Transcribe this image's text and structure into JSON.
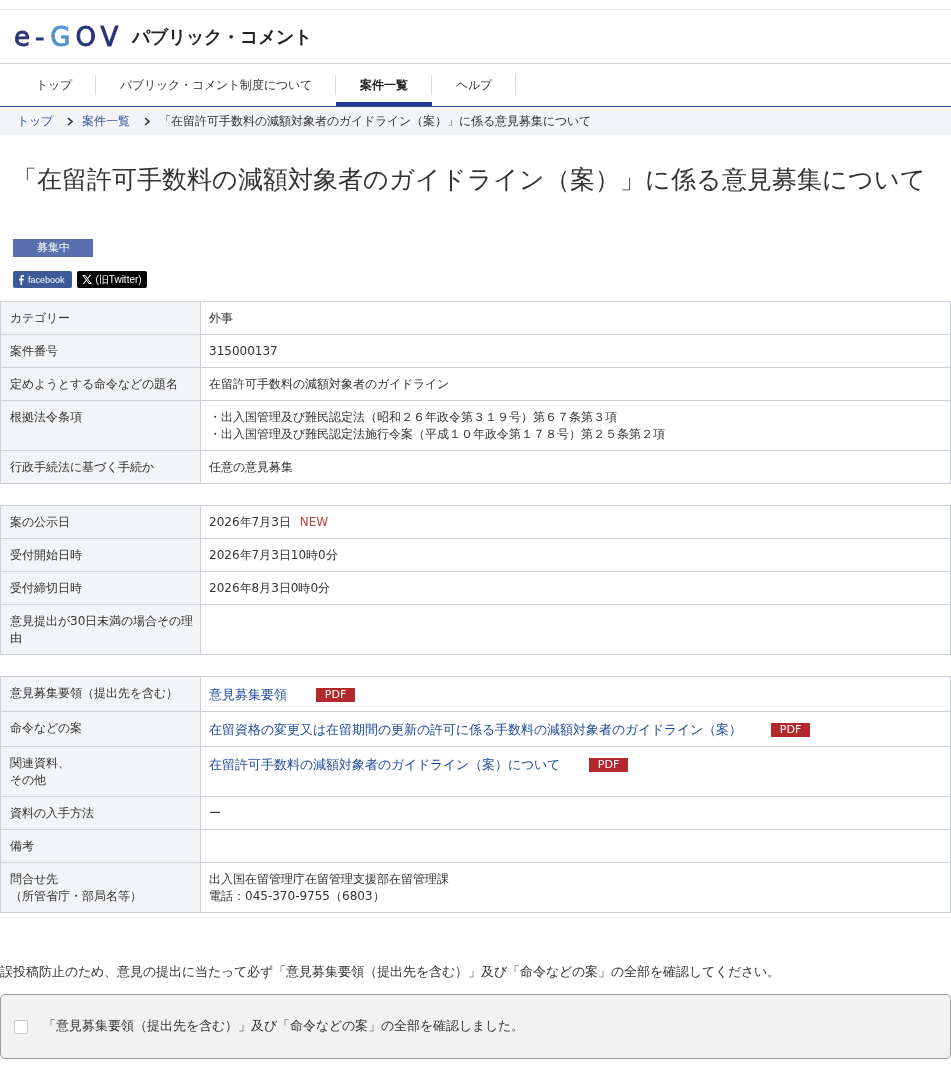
{
  "header": {
    "logo": "e-GOV",
    "title": "パブリック・コメント"
  },
  "nav": [
    {
      "label": "トップ",
      "selected": false
    },
    {
      "label": "パブリック・コメント制度について",
      "selected": false
    },
    {
      "label": "案件一覧",
      "selected": true
    },
    {
      "label": "ヘルプ",
      "selected": false
    }
  ],
  "breadcrumb": [
    {
      "kind": "link",
      "label": "トップ"
    },
    {
      "kind": "link",
      "label": "案件一覧"
    },
    {
      "kind": "current",
      "label": "「在留許可手数料の減額対象者のガイドライン（案）」に係る意見募集について"
    }
  ],
  "page_title": "「在留許可手数料の減額対象者のガイドライン（案）」に係る意見募集について",
  "status_badge": "募集中",
  "share_buttons": [
    {
      "kind": "facebook",
      "label": "facebook"
    },
    {
      "kind": "x",
      "label": "(旧Twitter)"
    }
  ],
  "sections": [
    {
      "rows": [
        {
          "label": [
            "カテゴリー"
          ],
          "values": [
            {
              "kind": "text",
              "text": "外事"
            }
          ]
        },
        {
          "label": [
            "案件番号"
          ],
          "values": [
            {
              "kind": "text",
              "text": "315000137"
            }
          ]
        },
        {
          "label": [
            "定めようとする命令などの題名"
          ],
          "values": [
            {
              "kind": "text",
              "text": "在留許可手数料の減額対象者のガイドライン"
            }
          ]
        },
        {
          "label": [
            "根拠法令条項"
          ],
          "values": [
            {
              "kind": "text",
              "text": "・出入国管理及び難民認定法（昭和２６年政令第３１９号）第６７条第３項"
            },
            {
              "kind": "text",
              "text": "・出入国管理及び難民認定法施行令案（平成１０年政令第１７８号）第２５条第２項"
            }
          ]
        },
        {
          "label": [
            "行政手続法に基づく手続か"
          ],
          "values": [
            {
              "kind": "text",
              "text": "任意の意見募集"
            }
          ]
        }
      ]
    },
    {
      "rows": [
        {
          "label": [
            "案の公示日"
          ],
          "values": [
            {
              "kind": "text",
              "text": "2026年7月3日",
              "tag": "NEW"
            }
          ]
        },
        {
          "label": [
            "受付開始日時"
          ],
          "values": [
            {
              "kind": "text",
              "text": "2026年7月3日10時0分"
            }
          ]
        },
        {
          "label": [
            "受付締切日時"
          ],
          "values": [
            {
              "kind": "text",
              "text": "2026年8月3日0時0分"
            }
          ]
        },
        {
          "label": [
            "意見提出が30日未満の場合その理由"
          ]
        }
      ]
    },
    {
      "rows": [
        {
          "label": [
            "意見募集要領（提出先を含む）"
          ],
          "values": [
            {
              "kind": "link",
              "text": "意見募集要領",
              "file": "PDF"
            }
          ]
        },
        {
          "label": [
            "命令などの案"
          ],
          "values": [
            {
              "kind": "link",
              "text": "在留資格の変更又は在留期間の更新の許可に係る手数料の減額対象者のガイドライン（案）",
              "file": "PDF"
            }
          ]
        },
        {
          "label": [
            "関連資料、",
            "その他"
          ],
          "values": [
            {
              "kind": "link",
              "text": "在留許可手数料の減額対象者のガイドライン（案）について",
              "file": "PDF"
            }
          ]
        },
        {
          "label": [
            "資料の入手方法"
          ],
          "values": [
            {
              "kind": "text",
              "text": "ー"
            }
          ]
        },
        {
          "label": [
            "備考"
          ]
        },
        {
          "label": [
            "問合せ先",
            "（所管省庁・部局名等）"
          ],
          "values": [
            {
              "kind": "text",
              "text": "出入国在留管理庁在留管理支援部在留管理課"
            },
            {
              "kind": "text",
              "text": "電話：045-370-9755（6803）"
            }
          ]
        }
      ]
    }
  ],
  "notice": "誤投稿防止のため、意見の提出に当たって必ず「意見募集要領（提出先を含む）」及び「命令などの案」の全部を確認してください。",
  "confirmation": {
    "label": "「意見募集要領（提出先を含む）」及び「命令などの案」の全部を確認しました。",
    "checked": false
  }
}
